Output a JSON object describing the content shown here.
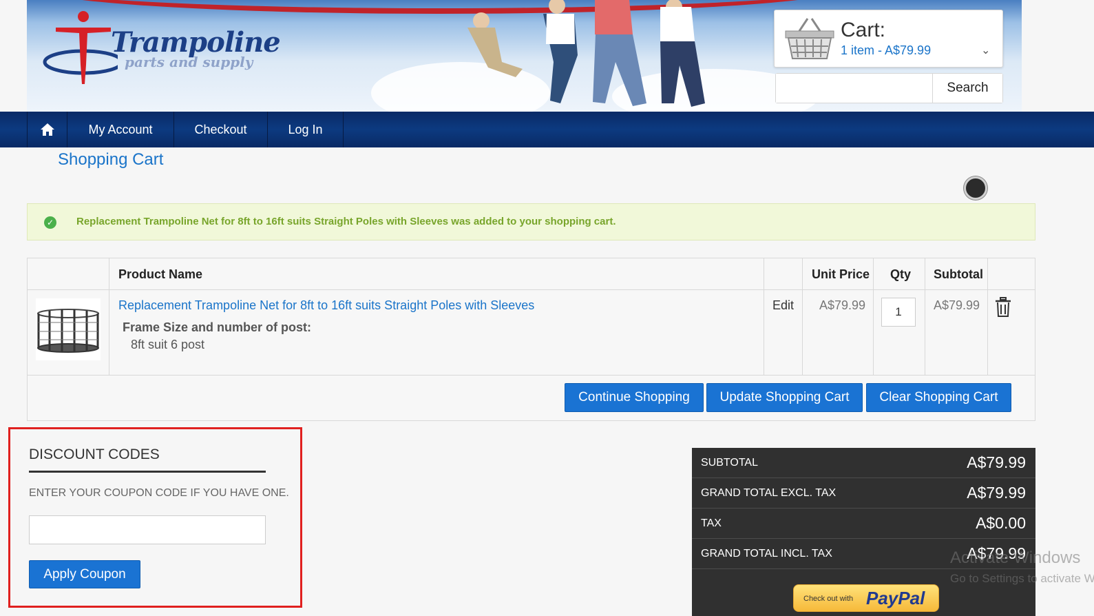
{
  "header": {
    "logo": {
      "word1": "Trampoline",
      "word2": "parts and supply"
    },
    "cart": {
      "title": "Cart:",
      "summary": "1 item - A$79.99"
    },
    "search": {
      "button_label": "Search",
      "placeholder": ""
    }
  },
  "nav": {
    "account": "My Account",
    "checkout": "Checkout",
    "login": "Log In"
  },
  "page_title": "Shopping Cart",
  "alert": {
    "message": "Replacement Trampoline Net for 8ft to 16ft suits Straight Poles with Sleeves was added to your shopping cart."
  },
  "table": {
    "headers": {
      "product": "Product Name",
      "unit_price": "Unit Price",
      "qty": "Qty",
      "subtotal": "Subtotal"
    },
    "rows": [
      {
        "name": "Replacement Trampoline Net for 8ft to 16ft suits Straight Poles with Sleeves",
        "option_label": "Frame Size and number of post:",
        "option_value": "8ft suit 6 post",
        "edit": "Edit",
        "unit_price": "A$79.99",
        "qty": "1",
        "subtotal": "A$79.99"
      }
    ],
    "buttons": {
      "continue": "Continue Shopping",
      "update": "Update Shopping Cart",
      "clear": "Clear Shopping Cart"
    }
  },
  "discount": {
    "title": "DISCOUNT CODES",
    "hint": "ENTER YOUR COUPON CODE IF YOU HAVE ONE.",
    "input_value": "",
    "apply_label": "Apply Coupon"
  },
  "totals": {
    "rows": [
      {
        "label": "SUBTOTAL",
        "value": "A$79.99"
      },
      {
        "label": "GRAND TOTAL EXCL. TAX",
        "value": "A$79.99"
      },
      {
        "label": "TAX",
        "value": "A$0.00"
      },
      {
        "label": "GRAND TOTAL INCL. TAX",
        "value": "A$79.99"
      }
    ],
    "paypal": {
      "small": "Check out with",
      "brand": "PayPal"
    }
  },
  "watermark": {
    "line1": "Activate Windows",
    "line2": "Go to Settings to activate Windows."
  },
  "colors": {
    "accent_blue": "#1a73d3",
    "nav_navy": "#0a2a66",
    "success_green": "#78a52b",
    "highlight_red": "#e0201f"
  }
}
